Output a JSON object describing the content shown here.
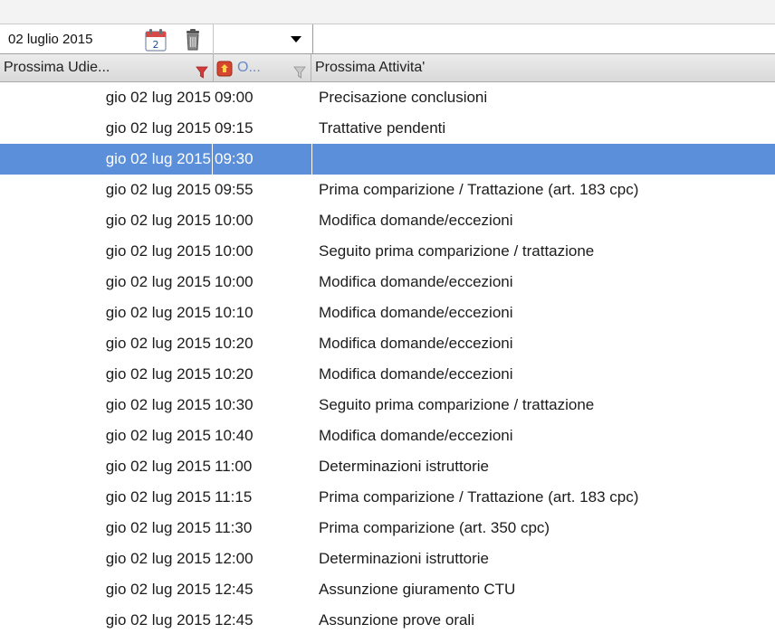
{
  "filterbar": {
    "date_value": "02 luglio 2015",
    "calendar_day": "2",
    "dropdown_value": "",
    "search_value": ""
  },
  "header": {
    "col1_label": "Prossima Udie...",
    "col2_label": "O...",
    "col3_label": "Prossima Attivita'"
  },
  "colors": {
    "selection": "#5b8fd9",
    "filter_active": "#d23b3b",
    "filter_inactive": "#a0a0a0"
  },
  "rows": [
    {
      "date": "gio 02 lug 2015",
      "time": "09:00",
      "activity": "Precisazione conclusioni",
      "selected": false
    },
    {
      "date": "gio 02 lug 2015",
      "time": "09:15",
      "activity": "Trattative pendenti",
      "selected": false
    },
    {
      "date": "gio 02 lug 2015",
      "time": "09:30",
      "activity": "",
      "selected": true
    },
    {
      "date": "gio 02 lug 2015",
      "time": "09:55",
      "activity": "Prima comparizione / Trattazione (art. 183 cpc)",
      "selected": false
    },
    {
      "date": "gio 02 lug 2015",
      "time": "10:00",
      "activity": "Modifica domande/eccezioni",
      "selected": false
    },
    {
      "date": "gio 02 lug 2015",
      "time": "10:00",
      "activity": "Seguito prima comparizione / trattazione",
      "selected": false
    },
    {
      "date": "gio 02 lug 2015",
      "time": "10:00",
      "activity": "Modifica domande/eccezioni",
      "selected": false
    },
    {
      "date": "gio 02 lug 2015",
      "time": "10:10",
      "activity": "Modifica domande/eccezioni",
      "selected": false
    },
    {
      "date": "gio 02 lug 2015",
      "time": "10:20",
      "activity": "Modifica domande/eccezioni",
      "selected": false
    },
    {
      "date": "gio 02 lug 2015",
      "time": "10:20",
      "activity": "Modifica domande/eccezioni",
      "selected": false
    },
    {
      "date": "gio 02 lug 2015",
      "time": "10:30",
      "activity": "Seguito prima comparizione / trattazione",
      "selected": false
    },
    {
      "date": "gio 02 lug 2015",
      "time": "10:40",
      "activity": "Modifica domande/eccezioni",
      "selected": false
    },
    {
      "date": "gio 02 lug 2015",
      "time": "11:00",
      "activity": "Determinazioni istruttorie",
      "selected": false
    },
    {
      "date": "gio 02 lug 2015",
      "time": "11:15",
      "activity": "Prima comparizione / Trattazione (art. 183 cpc)",
      "selected": false
    },
    {
      "date": "gio 02 lug 2015",
      "time": "11:30",
      "activity": "Prima comparizione (art. 350 cpc)",
      "selected": false
    },
    {
      "date": "gio 02 lug 2015",
      "time": "12:00",
      "activity": "Determinazioni istruttorie",
      "selected": false
    },
    {
      "date": "gio 02 lug 2015",
      "time": "12:45",
      "activity": "Assunzione giuramento CTU",
      "selected": false
    },
    {
      "date": "gio 02 lug 2015",
      "time": "12:45",
      "activity": "Assunzione prove orali",
      "selected": false
    }
  ]
}
